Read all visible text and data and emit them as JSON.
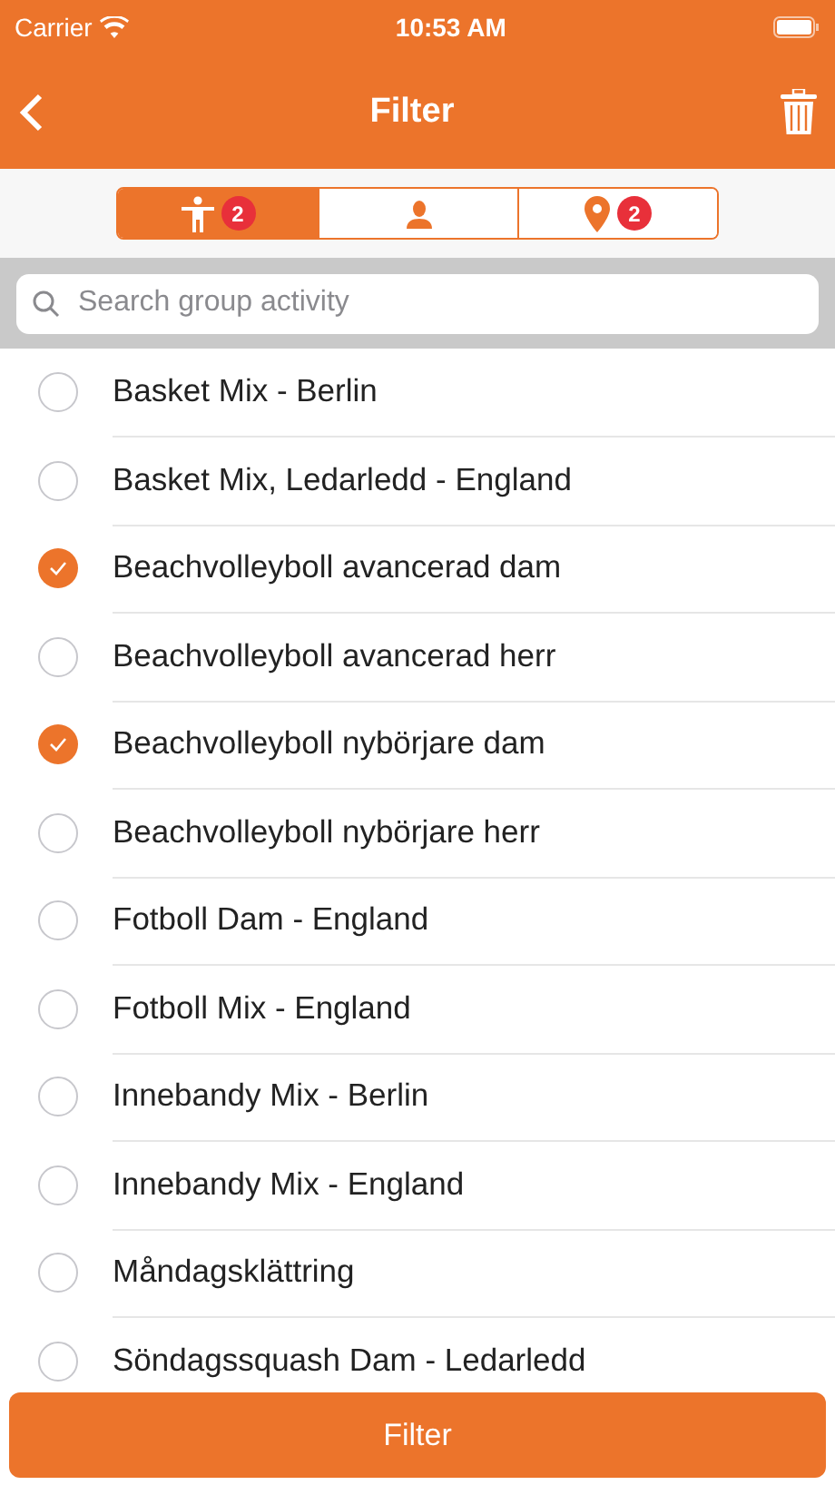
{
  "status_bar": {
    "carrier": "Carrier",
    "time": "10:53 AM"
  },
  "nav": {
    "title": "Filter"
  },
  "tabs": [
    {
      "kind": "activity",
      "badge": "2",
      "selected": true
    },
    {
      "kind": "person",
      "selected": false
    },
    {
      "kind": "location",
      "badge": "2",
      "selected": false
    }
  ],
  "search": {
    "placeholder": "Search group activity"
  },
  "items": [
    {
      "label": "Basket Mix - Berlin",
      "checked": false
    },
    {
      "label": "Basket Mix, Ledarledd - England",
      "checked": false
    },
    {
      "label": "Beachvolleyboll avancerad dam",
      "checked": true
    },
    {
      "label": "Beachvolleyboll avancerad herr",
      "checked": false
    },
    {
      "label": "Beachvolleyboll nybörjare dam",
      "checked": true
    },
    {
      "label": "Beachvolleyboll nybörjare herr",
      "checked": false
    },
    {
      "label": "Fotboll Dam - England",
      "checked": false
    },
    {
      "label": "Fotboll Mix - England",
      "checked": false
    },
    {
      "label": "Innebandy Mix - Berlin",
      "checked": false
    },
    {
      "label": "Innebandy Mix - England",
      "checked": false
    },
    {
      "label": "Måndagsklättring",
      "checked": false
    },
    {
      "label": "Söndagssquash Dam - Ledarledd",
      "checked": false
    }
  ],
  "button": "Filter"
}
